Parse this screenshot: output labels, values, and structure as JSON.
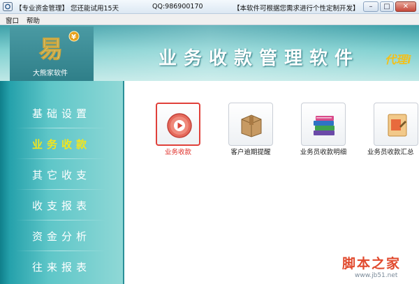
{
  "titlebar": {
    "app_name": "【专业资金管理】",
    "trial_notice": "您还能试用15天",
    "qq": "QQ:986900170",
    "custom_notice": "【本软件可根据您需求进行个性定制开发】",
    "minimize_icon": "minimize-icon",
    "maximize_icon": "maximize-icon",
    "close_icon": "close-icon"
  },
  "menu": {
    "items": [
      "窗口",
      "帮助"
    ]
  },
  "banner": {
    "logo_glyph": "易",
    "logo_badge": "¥",
    "company": "大熊家软件",
    "title": "业务收款管理软件",
    "subtitle": "代理i"
  },
  "sidebar": {
    "items": [
      {
        "label": "基础设置",
        "active": false
      },
      {
        "label": "业务收款",
        "active": true
      },
      {
        "label": "其它收支",
        "active": false
      },
      {
        "label": "收支报表",
        "active": false
      },
      {
        "label": "资金分析",
        "active": false
      },
      {
        "label": "往来报表",
        "active": false
      }
    ]
  },
  "tiles": [
    {
      "label": "业务收款",
      "icon": "play-circle-icon",
      "selected": true
    },
    {
      "label": "客户逾期提醒",
      "icon": "package-box-icon",
      "selected": false
    },
    {
      "label": "业务员收款明细",
      "icon": "book-stack-icon",
      "selected": false
    },
    {
      "label": "业务员收款汇总",
      "icon": "document-icon",
      "selected": false
    }
  ],
  "watermark": {
    "text": "脚本之家",
    "url": "www.jb51.net"
  },
  "colors": {
    "banner_teal": "#5ec6c8",
    "active_nav": "#f2e51e",
    "selected_tile_border": "#e0403a",
    "subtitle_gold": "#f3c01a"
  }
}
